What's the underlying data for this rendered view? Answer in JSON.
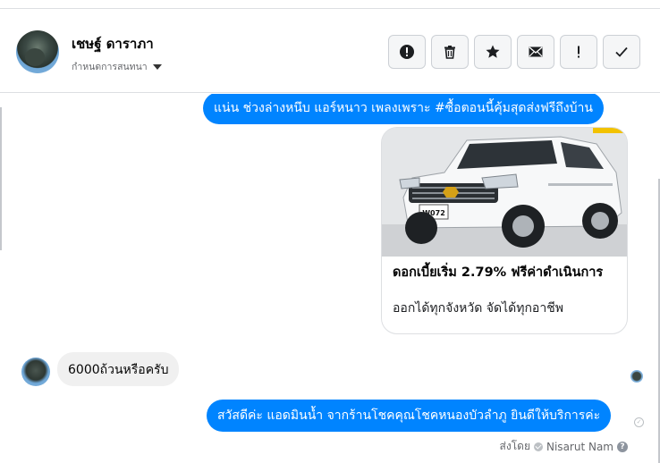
{
  "header": {
    "contact_name": "เชษฐ์ ดาราภา",
    "assign_label": "กำหนดการสนทนา",
    "actions": [
      {
        "name": "report-spam-button",
        "icon": "alert-octagon-icon"
      },
      {
        "name": "delete-button",
        "icon": "trash-icon"
      },
      {
        "name": "star-button",
        "icon": "star-icon"
      },
      {
        "name": "mark-unread-button",
        "icon": "envelope-icon"
      },
      {
        "name": "flag-button",
        "icon": "exclamation-icon"
      },
      {
        "name": "mark-done-button",
        "icon": "check-icon"
      }
    ]
  },
  "thread": {
    "outgoing_top": "แน่น ช่วงล่างหนึบ แอร์หนาว เพลงเพราะ #ซื้อตอนนี้คุ้มสุดส่งฟรีถึงบ้าน",
    "card": {
      "plate_text": "W072",
      "title": "ดอกเบี้ยเริ่ม 2.79% ฟรีค่าดำเนินการ",
      "description": "ออกได้ทุกจังหวัด จัดได้ทุกอาชีพ"
    },
    "incoming": "6000ถ้วนหรือครับ",
    "outgoing_reply": "สวัสดีค่ะ แอดมินน้ำ จากร้านโชคคุณโชคหนองบัวลำภู ยินดีให้บริการค่ะ",
    "sent_by_label": "ส่งโดย",
    "sent_by_name": "Nisarut Nam"
  },
  "colors": {
    "accent": "#0084ff",
    "incoming_bubble": "#f0f0f0",
    "border": "#dddfe2"
  }
}
